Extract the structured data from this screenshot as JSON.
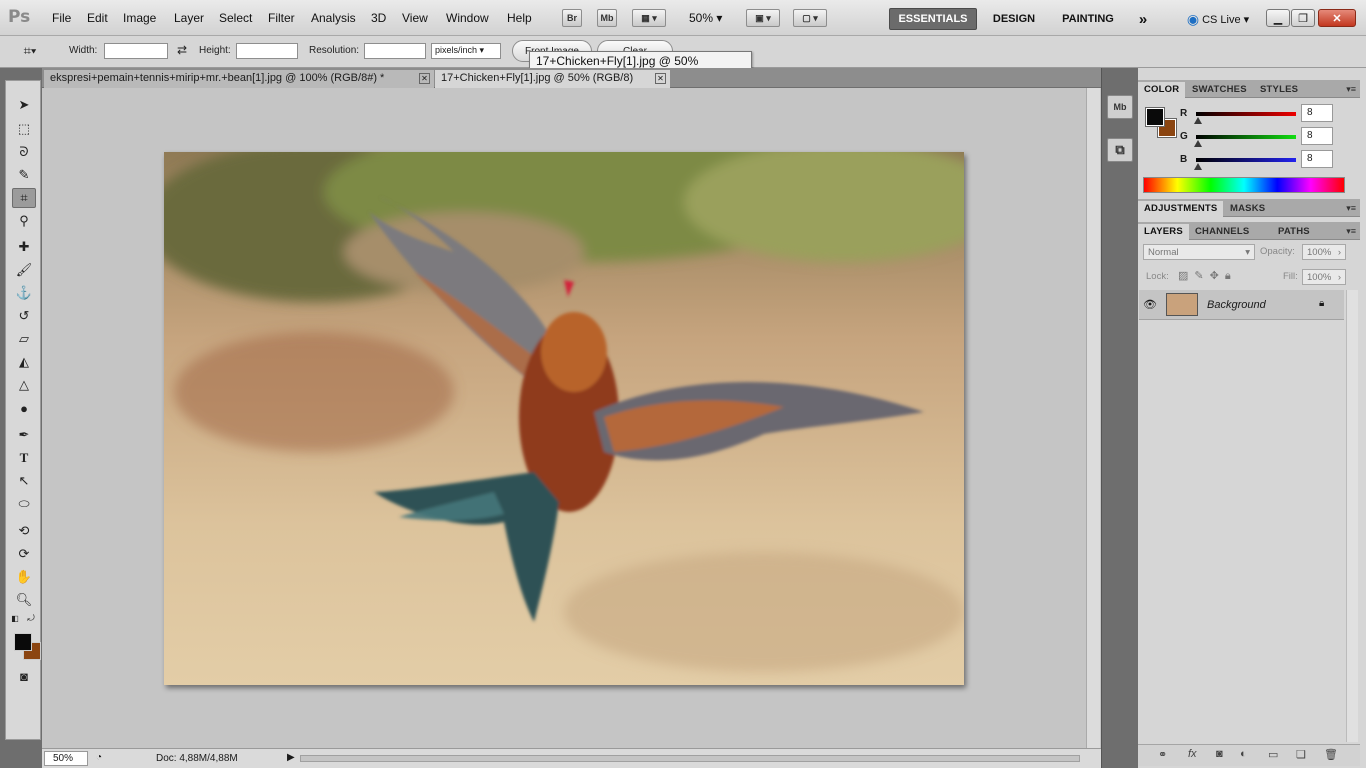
{
  "app": {
    "logo": "Ps"
  },
  "menu": [
    "File",
    "Edit",
    "Image",
    "Layer",
    "Select",
    "Filter",
    "Analysis",
    "3D",
    "View",
    "Window",
    "Help"
  ],
  "appbar": {
    "br_label": "Br",
    "mb_label": "Mb",
    "zoom": "50%",
    "workspaces": [
      "ESSENTIALS",
      "DESIGN",
      "PAINTING"
    ],
    "more": "»",
    "cs_live": "CS Live ▾"
  },
  "options": {
    "width_label": "Width:",
    "height_label": "Height:",
    "resolution_label": "Resolution:",
    "units": "pixels/inch",
    "front_image": "Front Image",
    "clear": "Clear",
    "width_value": "",
    "height_value": "",
    "resolution_value": ""
  },
  "tooltip": "17+Chicken+Fly[1].jpg @ 50% (RGB/8)",
  "tabs": [
    {
      "label": "ekspresi+pemain+tennis+mirip+mr.+bean[1].jpg @ 100% (RGB/8#) *"
    },
    {
      "label": "17+Chicken+Fly[1].jpg @ 50% (RGB/8)"
    }
  ],
  "status": {
    "zoom": "50%",
    "doc": "Doc: 4,88M/4,88M"
  },
  "color_panel": {
    "tabs": [
      "COLOR",
      "SWATCHES",
      "STYLES"
    ],
    "channels": [
      {
        "label": "R",
        "value": "8"
      },
      {
        "label": "G",
        "value": "8"
      },
      {
        "label": "B",
        "value": "8"
      }
    ],
    "foreground": "#0a0a0a",
    "background": "#8b4511"
  },
  "adjust_panel": {
    "tabs": [
      "ADJUSTMENTS",
      "MASKS"
    ]
  },
  "layers_panel": {
    "tabs": [
      "LAYERS",
      "CHANNELS",
      "PATHS"
    ],
    "blend_mode": "Normal",
    "opacity_label": "Opacity:",
    "opacity": "100%",
    "lock_label": "Lock:",
    "fill_label": "Fill:",
    "fill": "100%",
    "layers": [
      {
        "name": "Background",
        "visible": true,
        "locked": true
      }
    ]
  },
  "icon_column": {
    "mb": "Mb"
  }
}
